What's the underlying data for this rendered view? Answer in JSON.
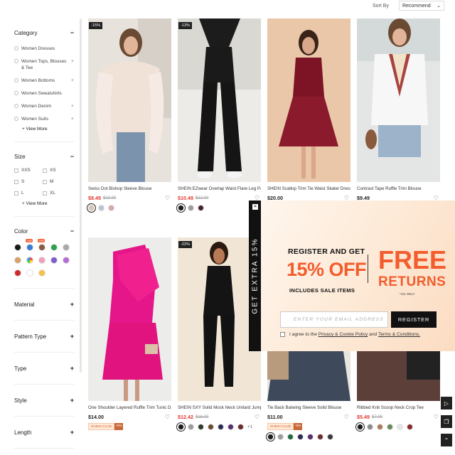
{
  "sort": {
    "label": "Sort By",
    "value": "Recommend"
  },
  "sidebar": {
    "category": {
      "title": "Category",
      "items": [
        {
          "label": "Women Dresses",
          "plus": ""
        },
        {
          "label": "Women Tops, Blouses & Tee",
          "plus": "+"
        },
        {
          "label": "Women Bottoms",
          "plus": "+"
        },
        {
          "label": "Women Sweatshirts",
          "plus": ""
        },
        {
          "label": "Women Denim",
          "plus": "+"
        },
        {
          "label": "Women Suits",
          "plus": "+"
        }
      ],
      "view_more": "+ View More"
    },
    "size": {
      "title": "Size",
      "items": [
        "XXS",
        "XS",
        "S",
        "M",
        "L",
        "XL"
      ],
      "view_more": "+ View More"
    },
    "color": {
      "title": "Color",
      "hot_label": "Hot",
      "swatches": [
        "#1a1a1a",
        "#3a7bd5",
        "#8a5a3c",
        "#2e9e4f",
        "#a9a9a9",
        "#d9a066",
        "multi",
        "#f0a0b8",
        "#7c5ccf",
        "#b36fd6",
        "#cf2a2a",
        "#ffffff",
        "#f5c24a"
      ]
    },
    "filters": [
      "Material",
      "Pattern Type",
      "Type",
      "Style",
      "Length"
    ]
  },
  "products": [
    {
      "discount": "-15%",
      "title": "Swiss Dot Bishop Sleeve Blouse",
      "price": "$8.49",
      "orig": "$10.00",
      "colors": [
        "#d9c4b8",
        "#b8c4d2",
        "#d6a7ad"
      ],
      "more": ""
    },
    {
      "discount": "-13%",
      "title": "SHEIN EZwear Overlap Waist Flare Leg Pants",
      "price": "$10.49",
      "orig": "$12.00",
      "colors": [
        "#1a1a1a",
        "#9c9c9c",
        "#4a1f2a"
      ],
      "more": ""
    },
    {
      "discount": "",
      "title": "SHEIN Scallop Trim Tie Waist Skater Dress",
      "price": "$20.00",
      "orig": "",
      "colors": [],
      "more": ""
    },
    {
      "discount": "",
      "title": "Contrast Tape Ruffle Trim Blouse",
      "price": "$9.49",
      "orig": "",
      "colors": [],
      "more": ""
    },
    {
      "discount": "",
      "title": "One Shoulder Layered Ruffle Trim Tunic Dress",
      "price": "$14.00",
      "orig": "",
      "colors": [],
      "more": "",
      "club": "SHEIN CLUB",
      "club_pct": "-5%"
    },
    {
      "discount": "-22%",
      "title": "SHEIN SXY Solid Mock Neck Unitard Jumpsuit",
      "price": "$12.42",
      "orig": "$16.00",
      "colors": [
        "#1a1a1a",
        "#9c9c9c",
        "#2f3b2a",
        "#6b4a2e",
        "#2a2a55",
        "#5a2d6e",
        "#6d2b2b"
      ],
      "more": "+1"
    },
    {
      "discount": "",
      "title": "Tie Back Batwing Sleeve Solid Blouse",
      "price": "$11.00",
      "orig": "",
      "colors": [
        "#1a1a1a",
        "#9c9c9c",
        "#1f6b3c",
        "#2a2a55",
        "#5a2d6e",
        "#6d2b2b",
        "#3a3a3a"
      ],
      "more": "",
      "club": "SHEIN CLUB",
      "club_pct": "-5%"
    },
    {
      "discount": "",
      "title": "Ribbed Knit Scoop Neck Crop Tee",
      "price": "$5.49",
      "orig": "$7.00",
      "colors": [
        "#1a1a1a",
        "#8a8a8a",
        "#b07a5a",
        "#6a8a5a",
        "#e6e6e6",
        "#8a2a2a"
      ],
      "more": ""
    }
  ],
  "promo": {
    "tab": "GET EXTRA 15%",
    "register_title": "REGISTER AND GET",
    "big_off": "15% OFF",
    "includes": "INCLUDES SALE ITEMS",
    "free": "FREE",
    "returns": "RETURNS",
    "us_only": "*US ONLY",
    "email_placeholder": "ENTER YOUR EMAIL ADDRESS",
    "register_btn": "REGISTER",
    "agree_prefix": "I agree to the",
    "privacy_link": "Privacy & Cookie Policy",
    "and": "and",
    "terms_link": "Terms & Conditions."
  }
}
